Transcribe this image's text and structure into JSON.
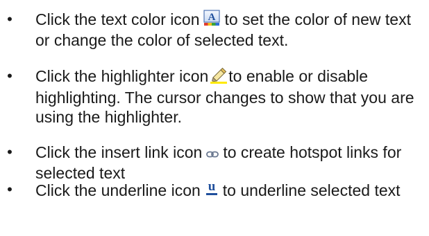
{
  "items": [
    {
      "bullet": "•",
      "before": "Click the text color icon",
      "icon": "text-color-icon",
      "after": "to set the color of new text or change the color of selected text."
    },
    {
      "bullet": "•",
      "before": "Click the highlighter icon",
      "icon": "highlighter-icon",
      "after": "to enable or disable highlighting. The cursor changes to show that you are using the highlighter."
    },
    {
      "bullet": "•",
      "before": "Click the insert link icon",
      "icon": "insert-link-icon",
      "after": "to create hotspot links for selected text"
    },
    {
      "bullet": "•",
      "before": "Click the underline icon",
      "icon": "underline-icon",
      "after": "to underline selected text"
    }
  ],
  "icons": {
    "text_color_letter": "A",
    "underline_letter": "u"
  },
  "colors": {
    "text": "#1a1a1a",
    "icon_blue": "#1f4f9c"
  }
}
